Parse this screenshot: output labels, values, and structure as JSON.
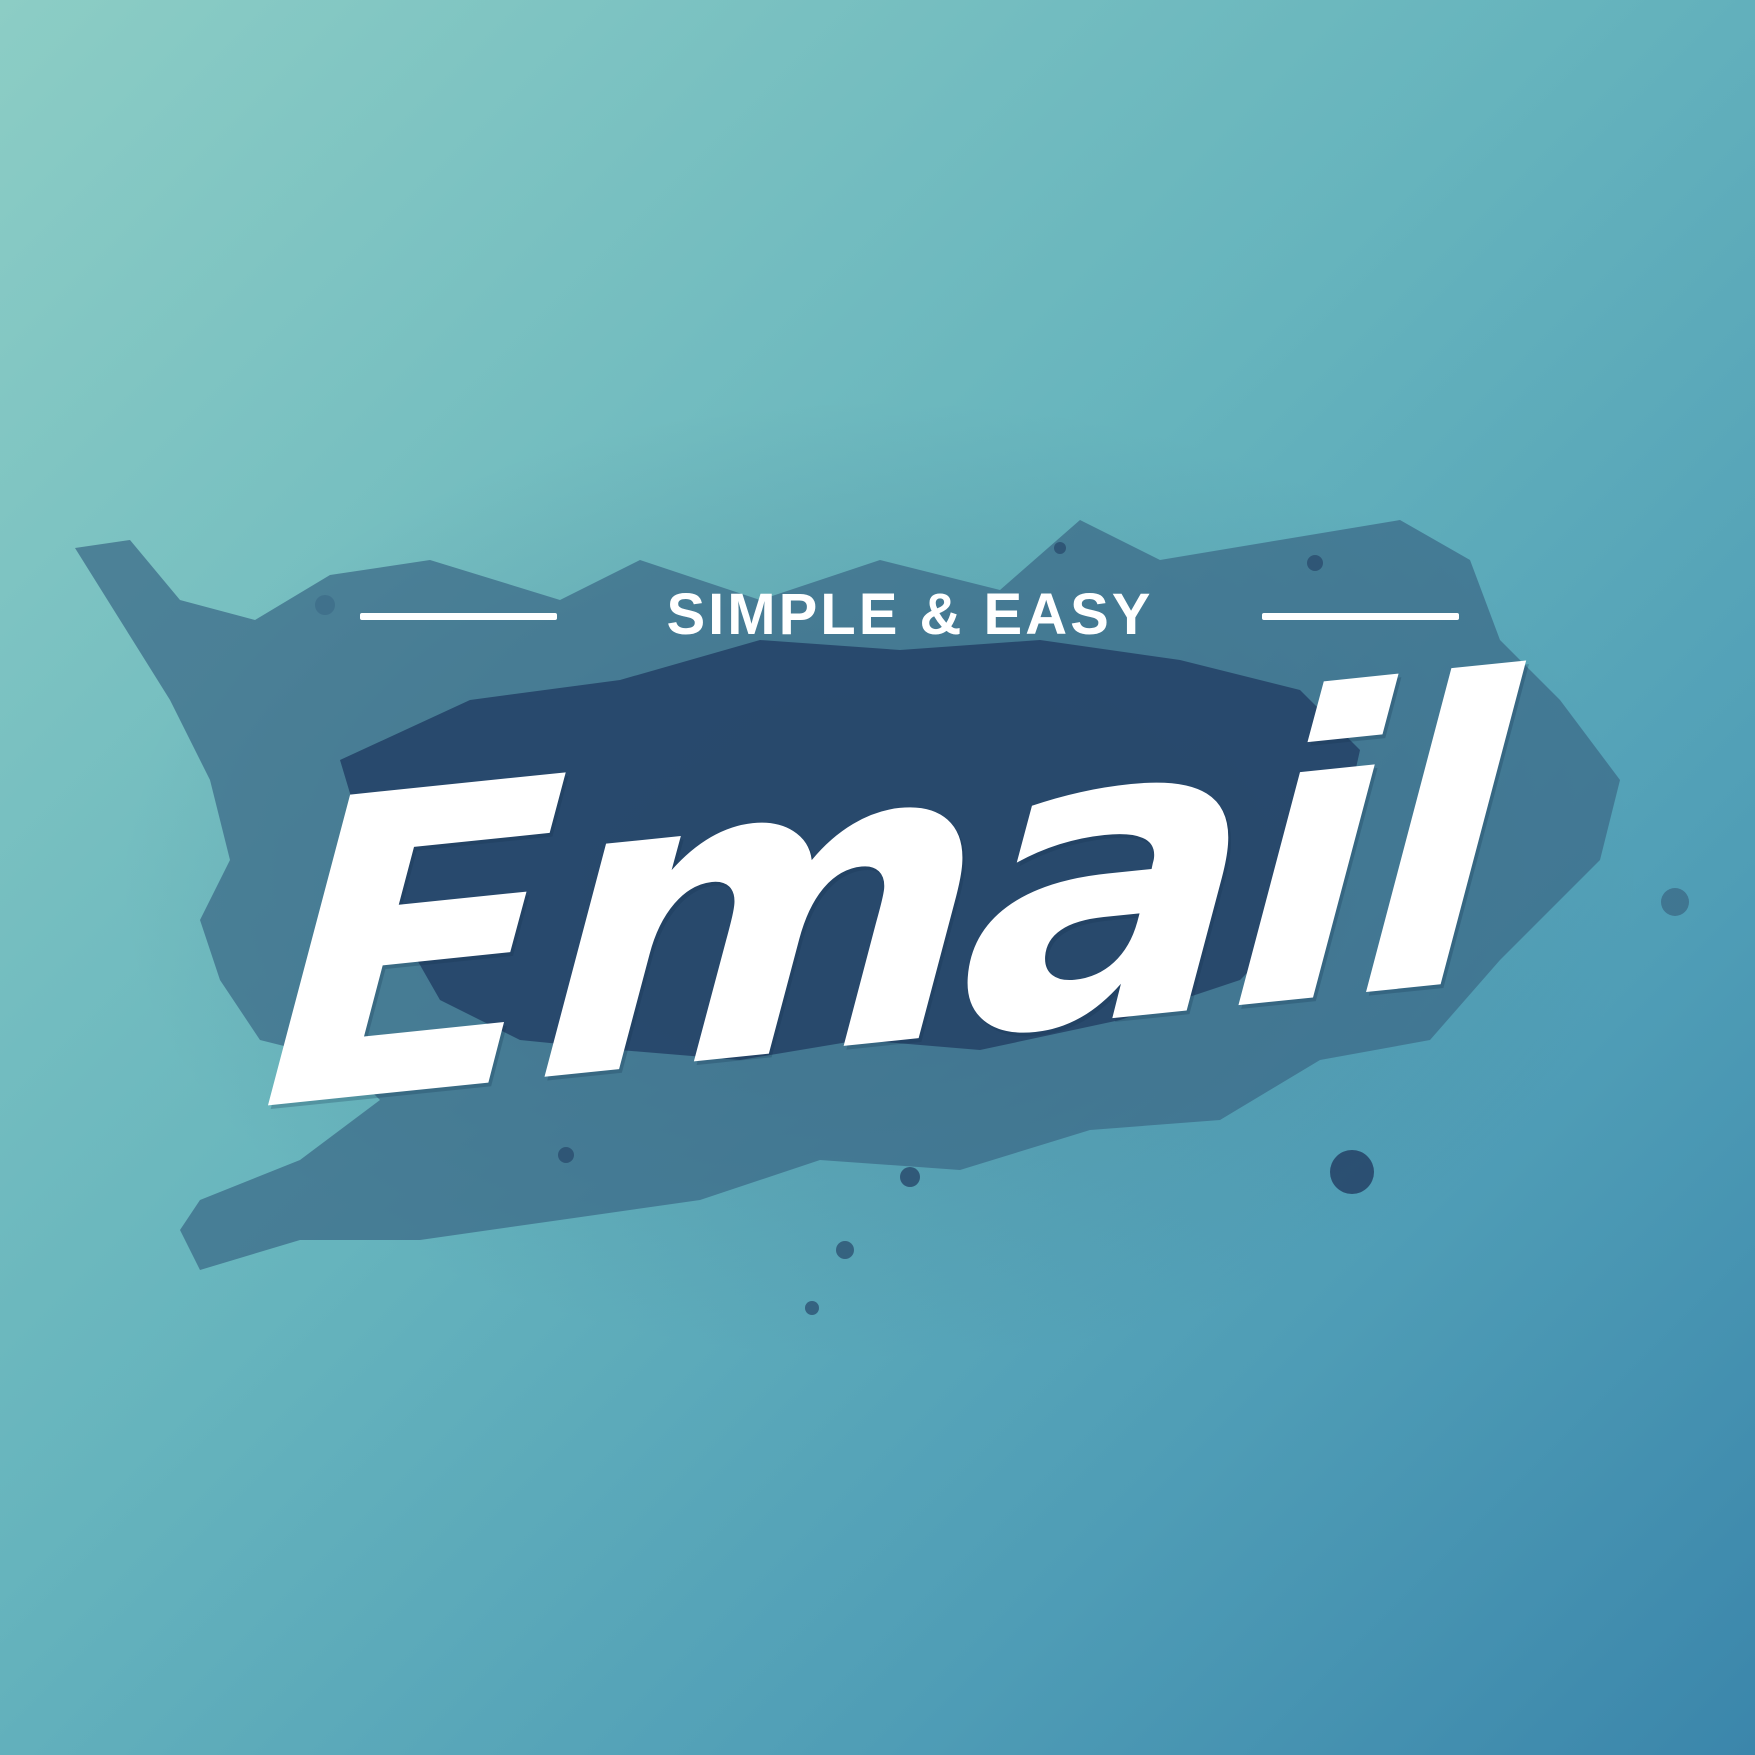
{
  "tagline": "SIMPLE & EASY",
  "headline": "Email",
  "colors": {
    "background_start": "#8ccdc5",
    "background_end": "#3b86ab",
    "splash_dark": "#27476a",
    "splash_mid": "#3c6b88",
    "text": "#ffffff"
  }
}
